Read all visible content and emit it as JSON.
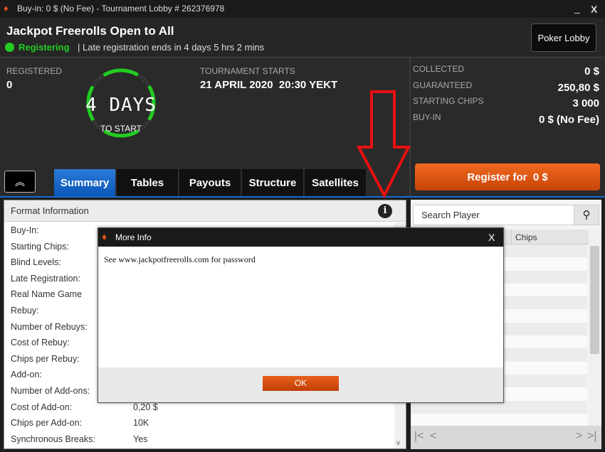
{
  "window": {
    "title": "Buy-in: 0 $ (No Fee) - Tournament Lobby # 262376978",
    "minimize": "_",
    "close": "X"
  },
  "header": {
    "tournament_name": "Jackpot Freerolls Open to All",
    "status": "Registering",
    "late_reg": "| Late registration ends in 4 days 5 hrs  2 mins",
    "poker_lobby": "Poker Lobby"
  },
  "stats": {
    "registered_label": "REGISTERED",
    "registered_value": "0",
    "countdown_value": "4 DAYS",
    "countdown_sub": "TO START",
    "starts_label": "TOURNAMENT STARTS",
    "starts_value": "21 APRIL 2020  20:30 YEKT"
  },
  "prize": {
    "items": [
      {
        "label": "COLLECTED",
        "value": "0 $"
      },
      {
        "label": "GUARANTEED",
        "value": "250,80 $"
      },
      {
        "label": "STARTING CHIPS",
        "value": "3 000"
      },
      {
        "label": "BUY-IN",
        "value": "0 $ (No Fee)"
      }
    ],
    "register_button": "Register for  0 $"
  },
  "tabs": [
    {
      "label": "Summary",
      "active": true
    },
    {
      "label": "Tables"
    },
    {
      "label": "Payouts"
    },
    {
      "label": "Structure"
    },
    {
      "label": "Satellites"
    }
  ],
  "format": {
    "title": "Format Information",
    "rows": [
      {
        "label": "Buy-In:",
        "value": ""
      },
      {
        "label": "Starting Chips:",
        "value": ""
      },
      {
        "label": "Blind Levels:",
        "value": ""
      },
      {
        "label": "Late Registration:",
        "value": ""
      },
      {
        "label": "Real Name Game",
        "value": ""
      },
      {
        "label": "Rebuy:",
        "value": ""
      },
      {
        "label": "Number of Rebuys:",
        "value": ""
      },
      {
        "label": "Cost of Rebuy:",
        "value": ""
      },
      {
        "label": "Chips per Rebuy:",
        "value": ""
      },
      {
        "label": "Add-on:",
        "value": ""
      },
      {
        "label": "Number of Add-ons:",
        "value": ""
      },
      {
        "label": "Cost of Add-on:",
        "value": "0,20 $"
      },
      {
        "label": "Chips per Add-on:",
        "value": "10K"
      },
      {
        "label": "Synchronous Breaks:",
        "value": "Yes"
      }
    ]
  },
  "players": {
    "search_placeholder": "Search Player",
    "col_chips": "Chips"
  },
  "modal": {
    "title": "More Info",
    "message": "See www.jackpotfreerolls.com for password",
    "ok": "OK",
    "close": "X"
  },
  "colors": {
    "accent": "#e05a10",
    "status": "#22cc22",
    "tab_active": "#1a6ad0",
    "arrow": "#e81010"
  }
}
